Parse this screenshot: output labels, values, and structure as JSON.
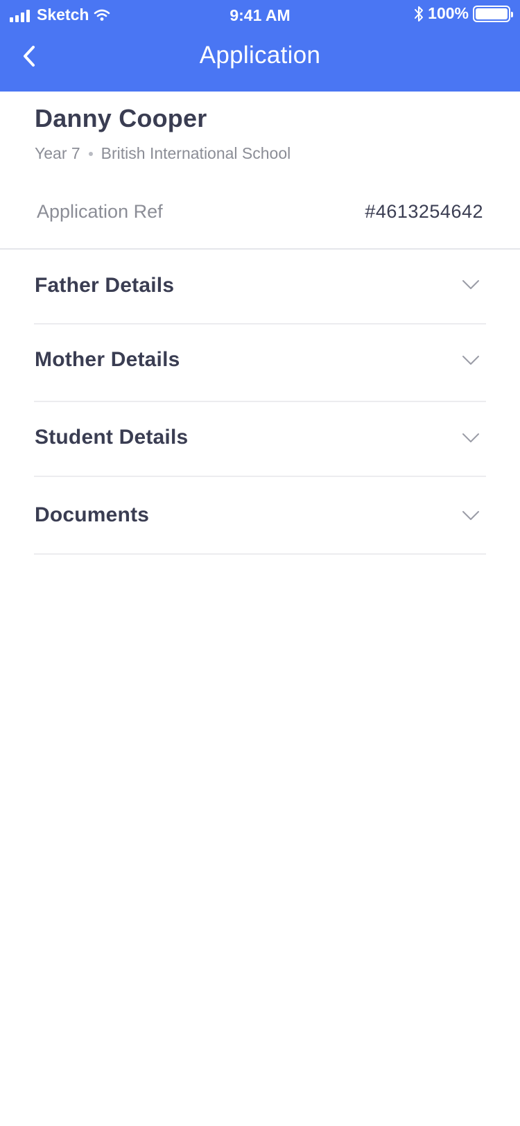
{
  "status_bar": {
    "carrier": "Sketch",
    "time": "9:41 AM",
    "battery_text": "100%",
    "battery_level": 1.0
  },
  "nav": {
    "title": "Application",
    "back_icon": "chevron-left-icon"
  },
  "profile": {
    "name": "Danny Cooper",
    "year": "Year 7",
    "school": "British International School"
  },
  "application_ref": {
    "label": "Application Ref",
    "value": "#4613254642"
  },
  "sections": [
    {
      "label": "Father Details",
      "icon": "chevron-down-icon"
    },
    {
      "label": "Mother Details",
      "icon": "chevron-down-icon"
    },
    {
      "label": "Student Details",
      "icon": "chevron-down-icon"
    },
    {
      "label": "Documents",
      "icon": "chevron-down-icon"
    }
  ],
  "colors": {
    "header": "#4a76f3",
    "text_primary": "#3a3d52",
    "text_secondary": "#8b8d96",
    "divider": "#e5e6ea"
  }
}
